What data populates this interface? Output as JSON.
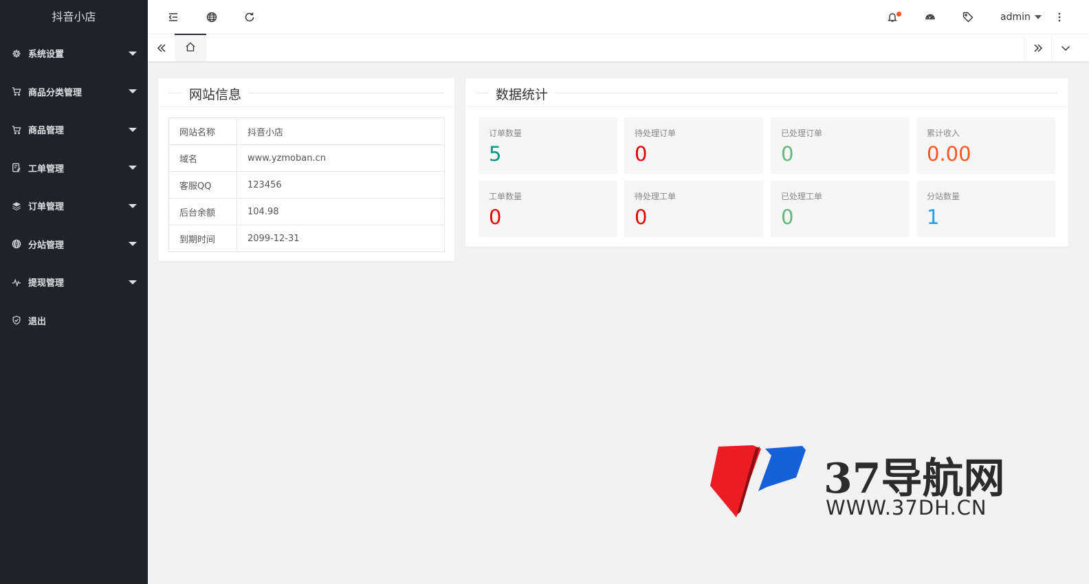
{
  "sidebar": {
    "brand": "抖音小店",
    "items": [
      {
        "label": "系统设置",
        "icon": "gear-icon"
      },
      {
        "label": "商品分类管理",
        "icon": "cart-icon"
      },
      {
        "label": "商品管理",
        "icon": "cart-icon"
      },
      {
        "label": "工单管理",
        "icon": "ticket-icon"
      },
      {
        "label": "订单管理",
        "icon": "layers-icon"
      },
      {
        "label": "分站管理",
        "icon": "globe-icon"
      },
      {
        "label": "提现管理",
        "icon": "pulse-icon"
      },
      {
        "label": "退出",
        "icon": "shield-check-icon"
      }
    ]
  },
  "header": {
    "user": "admin",
    "icons": [
      "menu-collapse-icon",
      "globe-icon",
      "refresh-icon",
      "bell-icon",
      "theme-palette-icon",
      "tag-icon",
      "more-vertical-icon"
    ],
    "notice_dot_color": "#ff5722"
  },
  "tabs": {
    "home_icon": "home-icon"
  },
  "site_info": {
    "title": "网站信息",
    "rows": [
      {
        "key": "网站名称",
        "value": "抖音小店"
      },
      {
        "key": "域名",
        "value": "www.yzmoban.cn"
      },
      {
        "key": "客服QQ",
        "value": "123456"
      },
      {
        "key": "后台余额",
        "value": "104.98"
      },
      {
        "key": "到期时间",
        "value": "2099-12-31"
      }
    ]
  },
  "stats": {
    "title": "数据统计",
    "items": [
      {
        "label": "订单数量",
        "value": "5",
        "color": "#009688"
      },
      {
        "label": "待处理订单",
        "value": "0",
        "color": "#e00000"
      },
      {
        "label": "已处理订单",
        "value": "0",
        "color": "#5fb878"
      },
      {
        "label": "累计收入",
        "value": "0.00",
        "color": "#ff5722"
      },
      {
        "label": "工单数量",
        "value": "0",
        "color": "#e00000"
      },
      {
        "label": "待处理工单",
        "value": "0",
        "color": "#e00000"
      },
      {
        "label": "已处理工单",
        "value": "0",
        "color": "#5fb878"
      },
      {
        "label": "分站数量",
        "value": "1",
        "color": "#1e9fff"
      }
    ]
  },
  "watermark": {
    "text": "37导航网",
    "url": "WWW.37DH.CN"
  }
}
